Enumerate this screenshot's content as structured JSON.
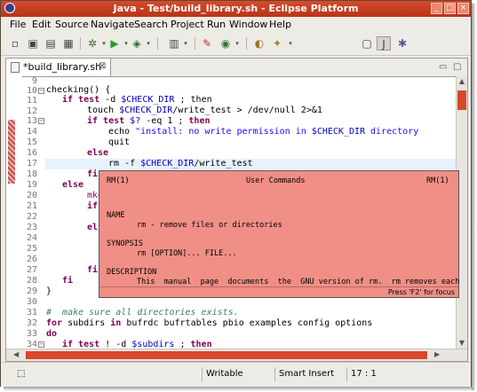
{
  "window": {
    "title": "Java - Test/build_library.sh - Eclipse Platform"
  },
  "menu": [
    "File",
    "Edit",
    "Source",
    "Navigate",
    "Search",
    "Project",
    "Run",
    "Window",
    "Help"
  ],
  "toolbar_icons": [
    "new-file-icon",
    "save-icon",
    "print-icon",
    "save-all-icon",
    "debug-icon",
    "run-icon",
    "external-tools-icon",
    "new-package-icon",
    "search-icon",
    "coverage-icon",
    "open-type-icon",
    "annotate-icon",
    "perspective-icon",
    "java-perspective-icon",
    "debug-perspective-icon"
  ],
  "editor": {
    "tab_label": "*build_library.sh",
    "lines": [
      {
        "n": "9"
      },
      {
        "n": "10"
      },
      {
        "n": "11"
      },
      {
        "n": "12"
      },
      {
        "n": "13"
      },
      {
        "n": "14"
      },
      {
        "n": "15"
      },
      {
        "n": "16"
      },
      {
        "n": "17"
      },
      {
        "n": "18"
      },
      {
        "n": "19"
      },
      {
        "n": "20"
      },
      {
        "n": "21"
      },
      {
        "n": "22"
      },
      {
        "n": "23"
      },
      {
        "n": "24"
      },
      {
        "n": "25"
      },
      {
        "n": "26"
      },
      {
        "n": "27"
      },
      {
        "n": "28"
      },
      {
        "n": "29"
      },
      {
        "n": "30"
      },
      {
        "n": "31"
      },
      {
        "n": "32"
      },
      {
        "n": "33"
      },
      {
        "n": "34"
      },
      {
        "n": "35"
      },
      {
        "n": "36"
      }
    ],
    "code": {
      "l10": "checking() {",
      "l11_kw": "if test",
      "l11_rest": " -d ",
      "l11_var": "$CHECK_DIR",
      "l11_end": " ; then",
      "l12_a": "touch ",
      "l12_var": "$CHECK_DIR",
      "l12_b": "/write_test > /dev/null 2>&1",
      "l13_kw": "if test",
      "l13_var": " $?",
      "l13_b": " -eq 1 ; ",
      "l13_kw2": "then",
      "l14_a": "echo ",
      "l14_str": "\"install: no write permission in ",
      "l14_var": "$CHECK_DIR",
      "l14_str2": " directory",
      "l15": "quit",
      "l16": "else",
      "l17_a": "rm -f ",
      "l17_var": "$CHECK_DIR",
      "l17_b": "/write_test",
      "l18": "fi",
      "l19": "else",
      "l20": "mkdi",
      "l21": "if t",
      "l23": "else",
      "l26": "fi",
      "l27": "fi",
      "l28": "}",
      "l30": "#  make sure all directories exists.",
      "l31_kw": "for",
      "l31_a": " subdirs ",
      "l31_kw2": "in",
      "l31_b": " bufrdc bufrtables pbio examples config options",
      "l32": "do",
      "l33_kw": "if test",
      "l33_a": " ! -d ",
      "l33_var": "$subdirs",
      "l33_b": " ; ",
      "l33_kw2": "then"
    }
  },
  "hover": {
    "left_header": "RM(1)",
    "center_header": "User Commands",
    "right_header": "RM(1)",
    "name_heading": "NAME",
    "name_text": "rm - remove files or directories",
    "synopsis_heading": "SYNOPSIS",
    "synopsis_text": "rm [OPTION]... FILE...",
    "description_heading": "DESCRIPTION",
    "description_text": "This  manual  page  documents  the  GNU version of rm.  rm removes each",
    "focus_hint": "Press 'F2' for focus"
  },
  "status": {
    "mode": "Writable",
    "insert": "Smart Insert",
    "position": "17 : 1"
  },
  "colors": {
    "title_bar": "#c83c22",
    "hover_bg": "#f08f86",
    "scroll_thumb": "#d9472c",
    "keyword": "#7f0055"
  }
}
